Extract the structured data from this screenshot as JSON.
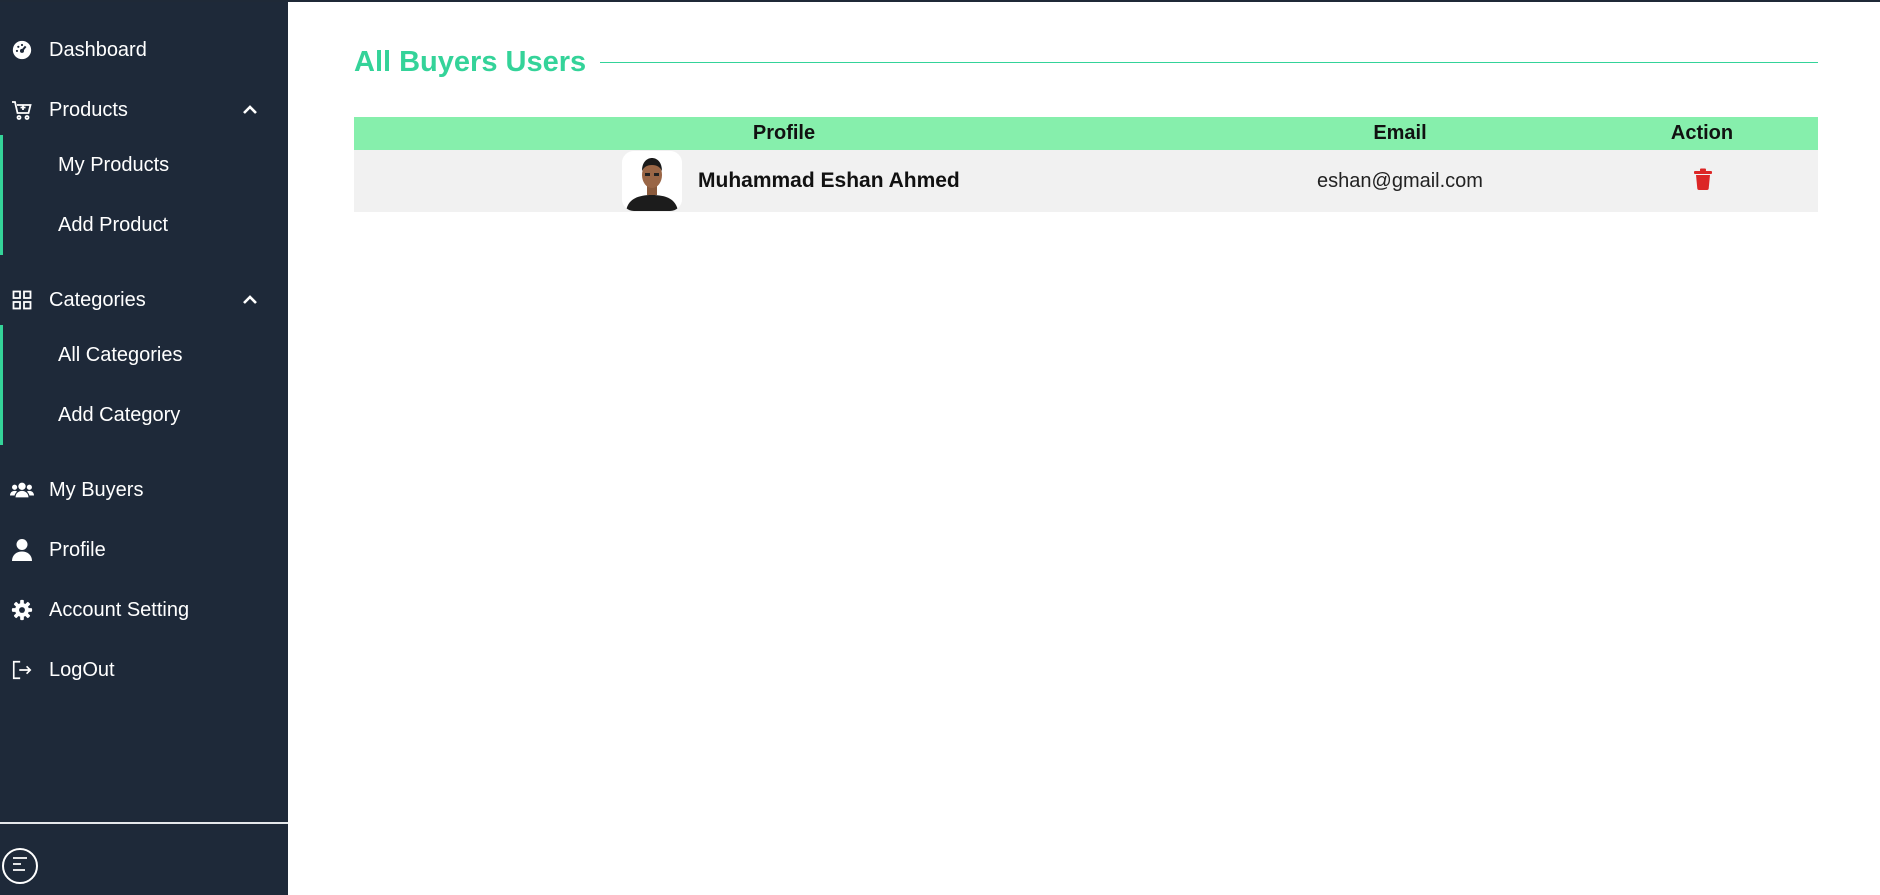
{
  "sidebar": {
    "items": [
      {
        "label": "Dashboard",
        "icon": "gauge-icon"
      },
      {
        "label": "Products",
        "icon": "cart-icon"
      },
      {
        "label": "Categories",
        "icon": "grid-icon"
      },
      {
        "label": "My Buyers",
        "icon": "users-icon"
      },
      {
        "label": "Profile",
        "icon": "user-icon"
      },
      {
        "label": "Account Setting",
        "icon": "gear-icon"
      },
      {
        "label": "LogOut",
        "icon": "logout-icon"
      }
    ],
    "products_sub": [
      "My Products",
      "Add Product"
    ],
    "categories_sub": [
      "All Categories",
      "Add Category"
    ]
  },
  "main": {
    "title": "All Buyers Users",
    "table": {
      "headers": {
        "profile": "Profile",
        "email": "Email",
        "action": "Action"
      },
      "rows": [
        {
          "name": "Muhammad Eshan Ahmed",
          "email": "eshan@gmail.com"
        }
      ]
    }
  },
  "colors": {
    "sidebar_bg": "#1e2939",
    "accent": "#34d399",
    "header_bg": "#86efac",
    "delete": "#dc2626"
  }
}
